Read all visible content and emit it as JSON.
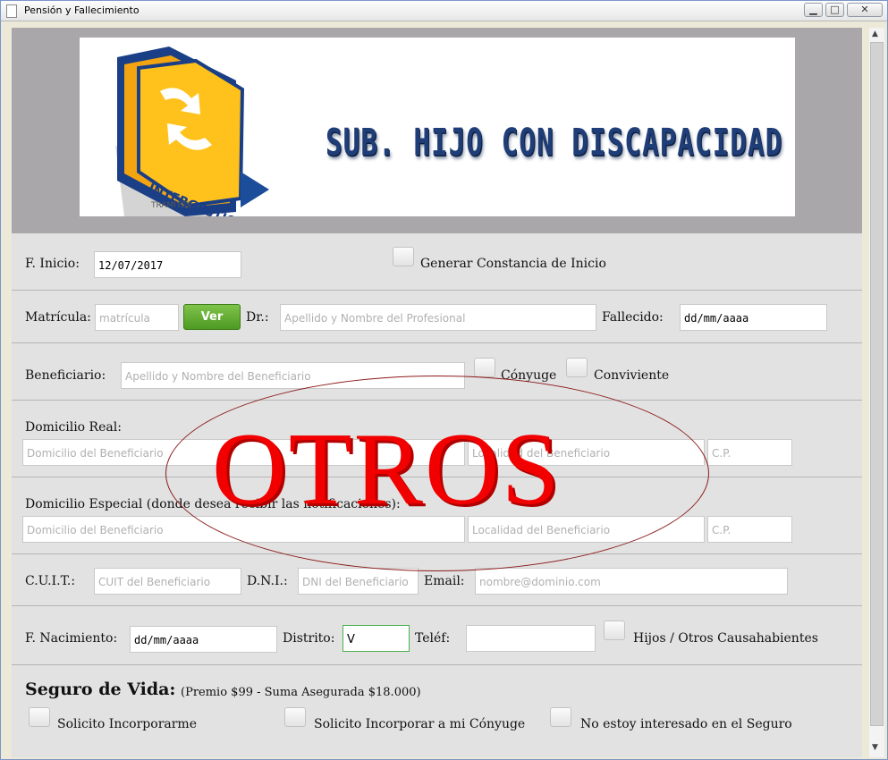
{
  "window": {
    "title": "Pensión y Fallecimiento",
    "min_glyph": "▁",
    "max_glyph": "□",
    "close_glyph": "✕"
  },
  "banner": {
    "heading": "SUB. HIJO CON DISCAPACIDAD",
    "logo_text": "INTERGESTION",
    "logo_sub": "TRAMITES"
  },
  "inicio": {
    "label": "F. Inicio:",
    "value": "12/07/2017",
    "constancia_label": "Generar Constancia de Inicio"
  },
  "matricula": {
    "label": "Matrícula:",
    "placeholder": "matrícula",
    "ver_button": "Ver",
    "dr_label": "Dr.:",
    "dr_placeholder": "Apellido y Nombre del Profesional",
    "fallecido_label": "Fallecido:",
    "fallecido_value": "dd/mm/aaaa"
  },
  "beneficiario": {
    "label": "Beneficiario:",
    "placeholder": "Apellido y Nombre del Beneficiario",
    "conyuge_label": "Cónyuge",
    "conviviente_label": "Conviviente"
  },
  "domicilio_real": {
    "label": "Domicilio Real:",
    "domicilio_placeholder": "Domicilio del Beneficiario",
    "localidad_placeholder": "Localidad del Beneficiario",
    "cp_placeholder": "C.P."
  },
  "domicilio_especial": {
    "label": "Domicilio Especial (donde desea recibir las notificaciones):",
    "domicilio_placeholder": "Domicilio del Beneficiario",
    "localidad_placeholder": "Localidad del Beneficiario",
    "cp_placeholder": "C.P."
  },
  "ids": {
    "cuit_label": "C.U.I.T.:",
    "cuit_placeholder": "CUIT del Beneficiario",
    "dni_label": "D.N.I.:",
    "dni_placeholder": "DNI del Beneficiario",
    "email_label": "Email:",
    "email_placeholder": "nombre@dominio.com"
  },
  "nacimiento": {
    "label": "F. Nacimiento:",
    "value": "dd/mm/aaaa",
    "distrito_label": "Distrito:",
    "distrito_value": "V",
    "telef_label": "Teléf:",
    "hijos_label": "Hijos / Otros Causahabientes"
  },
  "seguro": {
    "title": "Seguro de Vida:",
    "subtitle": "(Premio $99 - Suma Asegurada $18.000)",
    "opt1": "Solicito Incorporarme",
    "opt2": "Solicito Incorporar a mi Cónyuge",
    "opt3": "No estoy interesado en el Seguro"
  },
  "stamp": {
    "text": "OTROS"
  },
  "colors": {
    "stamp_red": "#f20000",
    "ver_green": "#5aa52b",
    "heading_blue": "#1f3d77"
  }
}
